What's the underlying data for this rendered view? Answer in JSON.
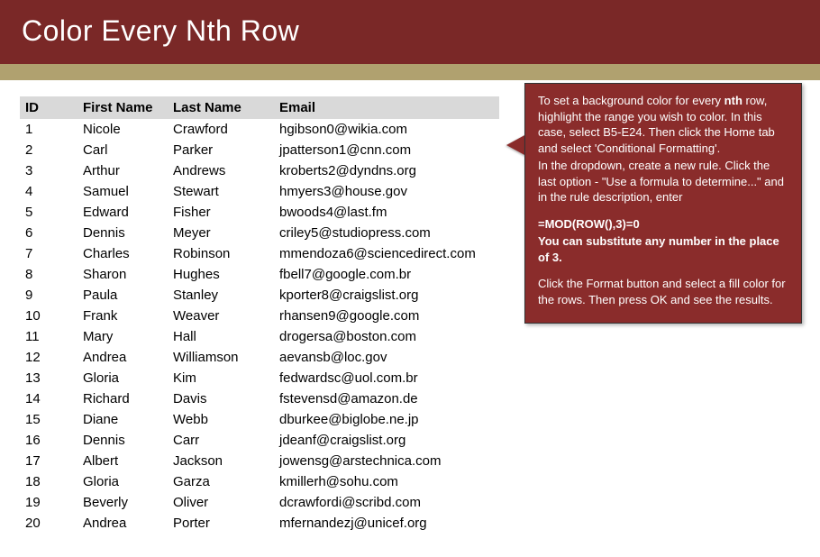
{
  "title": "Color Every Nth Row",
  "table": {
    "headers": {
      "id": "ID",
      "first": "First Name",
      "last": "Last Name",
      "email": "Email"
    },
    "rows": [
      {
        "id": "1",
        "first": "Nicole",
        "last": "Crawford",
        "email": "hgibson0@wikia.com"
      },
      {
        "id": "2",
        "first": "Carl",
        "last": "Parker",
        "email": "jpatterson1@cnn.com"
      },
      {
        "id": "3",
        "first": "Arthur",
        "last": "Andrews",
        "email": "kroberts2@dyndns.org"
      },
      {
        "id": "4",
        "first": "Samuel",
        "last": "Stewart",
        "email": "hmyers3@house.gov"
      },
      {
        "id": "5",
        "first": "Edward",
        "last": "Fisher",
        "email": "bwoods4@last.fm"
      },
      {
        "id": "6",
        "first": "Dennis",
        "last": "Meyer",
        "email": "criley5@studiopress.com"
      },
      {
        "id": "7",
        "first": "Charles",
        "last": "Robinson",
        "email": "mmendoza6@sciencedirect.com"
      },
      {
        "id": "8",
        "first": "Sharon",
        "last": "Hughes",
        "email": "fbell7@google.com.br"
      },
      {
        "id": "9",
        "first": "Paula",
        "last": "Stanley",
        "email": "kporter8@craigslist.org"
      },
      {
        "id": "10",
        "first": "Frank",
        "last": "Weaver",
        "email": "rhansen9@google.com"
      },
      {
        "id": "11",
        "first": "Mary",
        "last": "Hall",
        "email": "drogersa@boston.com"
      },
      {
        "id": "12",
        "first": "Andrea",
        "last": "Williamson",
        "email": "aevansb@loc.gov"
      },
      {
        "id": "13",
        "first": "Gloria",
        "last": "Kim",
        "email": "fedwardsc@uol.com.br"
      },
      {
        "id": "14",
        "first": "Richard",
        "last": "Davis",
        "email": "fstevensd@amazon.de"
      },
      {
        "id": "15",
        "first": "Diane",
        "last": "Webb",
        "email": "dburkee@biglobe.ne.jp"
      },
      {
        "id": "16",
        "first": "Dennis",
        "last": "Carr",
        "email": "jdeanf@craigslist.org"
      },
      {
        "id": "17",
        "first": "Albert",
        "last": "Jackson",
        "email": "jowensg@arstechnica.com"
      },
      {
        "id": "18",
        "first": "Gloria",
        "last": "Garza",
        "email": "kmillerh@sohu.com"
      },
      {
        "id": "19",
        "first": "Beverly",
        "last": "Oliver",
        "email": "dcrawfordi@scribd.com"
      },
      {
        "id": "20",
        "first": "Andrea",
        "last": "Porter",
        "email": "mfernandezj@unicef.org"
      }
    ]
  },
  "callout": {
    "p1a": "To set a background color for every ",
    "p1b": "nth",
    "p1c": " row, highlight the range you wish to color. In this case, select B5-E24. Then click the Home tab and select 'Conditional Formatting'.",
    "p2": "In the dropdown, create a new rule. Click the last option - \"Use a formula to determine...\" and in the rule description, enter",
    "formula": "=MOD(ROW(),3)=0",
    "note": "You can substitute any number in the place of 3.",
    "p3": "Click the Format button and select a fill color for the rows. Then press OK and see the results."
  }
}
